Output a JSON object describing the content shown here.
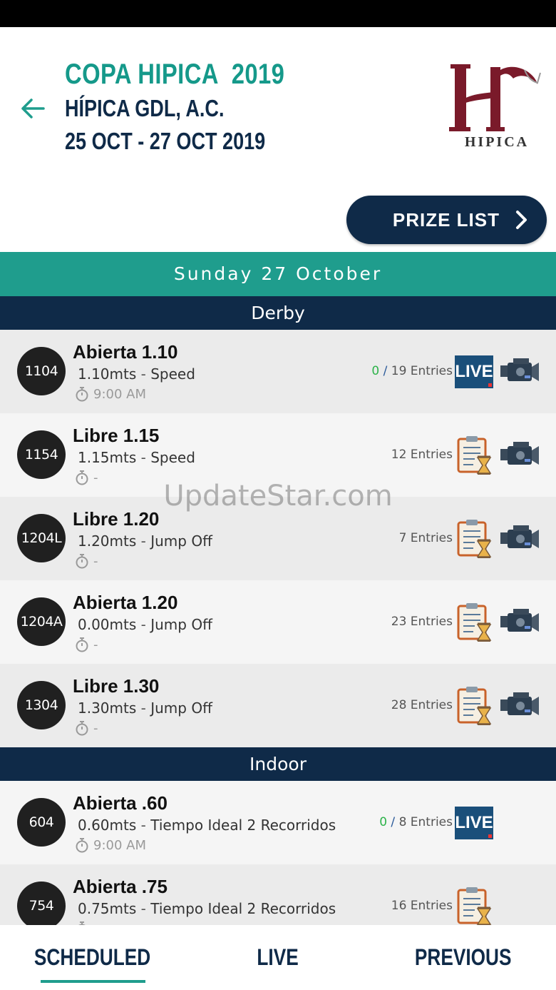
{
  "header": {
    "event": "COPA HIPICA  2019",
    "organizer": "HÍPICA GDL, A.C.",
    "dates": "25 OCT - 27 OCT 2019",
    "logo_text": "HIPICA",
    "prize_button": "PRIZE LIST"
  },
  "date_label": "Sunday 27 October",
  "sections": [
    {
      "name": "Derby",
      "rows": [
        {
          "number": "1104",
          "name": "Abierta 1.10",
          "height": "1.10mts",
          "type": "Speed",
          "time": "9:00 AM",
          "entries_done": "0",
          "entries_total": "19 Entries",
          "status": "live"
        },
        {
          "number": "1154",
          "name": "Libre 1.15",
          "height": "1.15mts",
          "type": "Speed",
          "time": "-",
          "entries_total": "12 Entries",
          "status": "pending"
        },
        {
          "number": "1204L",
          "name": "Libre 1.20",
          "height": "1.20mts",
          "type": "Jump Off",
          "time": "-",
          "entries_total": "7 Entries",
          "status": "pending"
        },
        {
          "number": "1204A",
          "name": "Abierta 1.20",
          "height": "0.00mts",
          "type": "Jump Off",
          "time": "-",
          "entries_total": "23 Entries",
          "status": "pending"
        },
        {
          "number": "1304",
          "name": "Libre 1.30",
          "height": "1.30mts",
          "type": "Jump Off",
          "time": "-",
          "entries_total": "28 Entries",
          "status": "pending"
        }
      ]
    },
    {
      "name": "Indoor",
      "rows": [
        {
          "number": "604",
          "name": "Abierta .60",
          "height": "0.60mts",
          "type": "Tiempo Ideal 2 Recorridos",
          "time": "9:00 AM",
          "entries_done": "0",
          "entries_total": "8 Entries",
          "status": "live"
        },
        {
          "number": "754",
          "name": "Abierta .75",
          "height": "0.75mts",
          "type": "Tiempo Ideal 2 Recorridos",
          "time": "",
          "entries_total": "16 Entries",
          "status": "pending"
        }
      ]
    }
  ],
  "live_label": "LIVE",
  "watermark": "UpdateStar.com",
  "nav": {
    "scheduled": "SCHEDULED",
    "live": "LIVE",
    "previous": "PREVIOUS"
  },
  "colors": {
    "teal": "#1f9d8d",
    "navy": "#0f2a48",
    "live_blue": "#1a4f7a",
    "logo_red": "#7a1a2a"
  }
}
